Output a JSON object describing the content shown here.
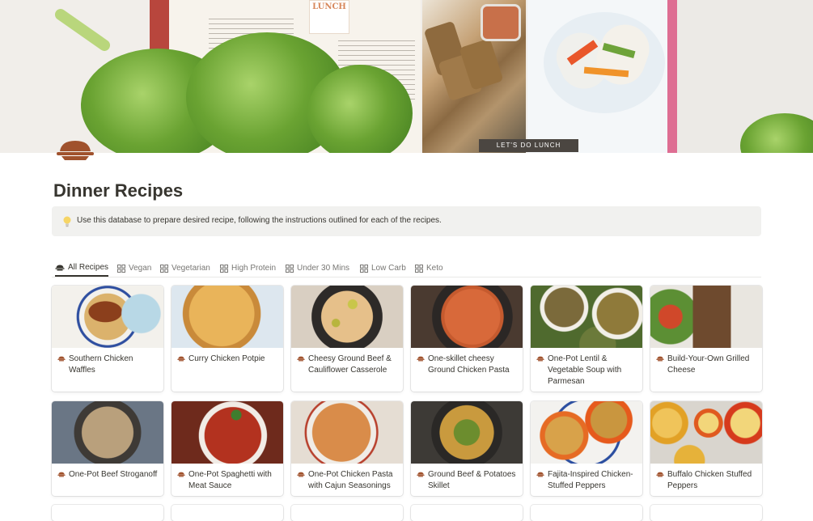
{
  "cover": {
    "lunch_tag": "LUNCH",
    "banner_text": "LET'S DO LUNCH"
  },
  "page": {
    "title": "Dinner Recipes",
    "callout_text": "Use this database to prepare desired recipe, following the instructions outlined for each of the recipes."
  },
  "tabs": [
    {
      "label": "All Recipes",
      "icon": "dish-icon",
      "active": true
    },
    {
      "label": "Vegan",
      "icon": "gallery-icon"
    },
    {
      "label": "Vegetarian",
      "icon": "gallery-icon"
    },
    {
      "label": "High Protein",
      "icon": "gallery-icon"
    },
    {
      "label": "Under 30 Mins",
      "icon": "gallery-icon"
    },
    {
      "label": "Low Carb",
      "icon": "gallery-icon"
    },
    {
      "label": "Keto",
      "icon": "gallery-icon"
    }
  ],
  "recipes": [
    {
      "title": "Southern Chicken Waffles"
    },
    {
      "title": "Curry Chicken Potpie"
    },
    {
      "title": "Cheesy Ground Beef & Cauliflower Casserole"
    },
    {
      "title": "One-skillet cheesy Ground Chicken Pasta"
    },
    {
      "title": "One-Pot Lentil & Vegetable Soup with Parmesan"
    },
    {
      "title": "Build-Your-Own Grilled Cheese"
    },
    {
      "title": "One-Pot Beef Stroganoff"
    },
    {
      "title": "One-Pot Spaghetti with Meat Sauce"
    },
    {
      "title": "One-Pot Chicken Pasta with Cajun Seasonings"
    },
    {
      "title": "Ground Beef & Potatoes Skillet"
    },
    {
      "title": "Fajita-Inspired Chicken-Stuffed Peppers"
    },
    {
      "title": "Buffalo Chicken Stuffed Peppers"
    }
  ],
  "colors": {
    "accent": "#37352f",
    "muted": "#787774",
    "callout_bg": "#f1f1ef",
    "dish_icon": "#a0522d"
  }
}
